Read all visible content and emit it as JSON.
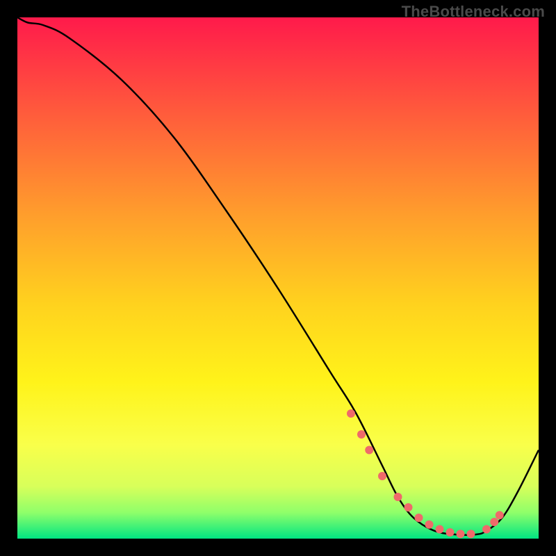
{
  "watermark": "TheBottleneck.com",
  "chart_data": {
    "type": "line",
    "title": "",
    "xlabel": "",
    "ylabel": "",
    "xlim": [
      0,
      100
    ],
    "ylim": [
      0,
      100
    ],
    "grid": false,
    "legend": false,
    "gradient_stops": [
      {
        "offset": 0.0,
        "color": "#ff1a4b"
      },
      {
        "offset": 0.18,
        "color": "#ff5a3c"
      },
      {
        "offset": 0.38,
        "color": "#ff9e2c"
      },
      {
        "offset": 0.55,
        "color": "#ffd21e"
      },
      {
        "offset": 0.7,
        "color": "#fff31a"
      },
      {
        "offset": 0.82,
        "color": "#f9ff4a"
      },
      {
        "offset": 0.9,
        "color": "#d8ff5a"
      },
      {
        "offset": 0.95,
        "color": "#8fff6a"
      },
      {
        "offset": 1.0,
        "color": "#00e582"
      }
    ],
    "series": [
      {
        "name": "bottleneck-curve",
        "color": "#000000",
        "x": [
          0,
          2,
          5,
          10,
          20,
          30,
          40,
          50,
          60,
          65,
          70,
          73,
          76,
          80,
          84,
          88,
          90,
          93,
          96,
          100
        ],
        "y": [
          100,
          99,
          98.5,
          96,
          88,
          77,
          63,
          48,
          32,
          24,
          14,
          8,
          4,
          1.5,
          0.8,
          0.8,
          1.5,
          4,
          9,
          17
        ]
      }
    ],
    "markers": {
      "name": "highlight-dots",
      "color": "#ef6a6a",
      "radius": 6,
      "x": [
        64,
        66,
        67.5,
        70,
        73,
        75,
        77,
        79,
        81,
        83,
        85,
        87,
        90,
        91.5,
        92.5
      ],
      "y": [
        24,
        20,
        17,
        12,
        8,
        6,
        4,
        2.7,
        1.8,
        1.2,
        0.9,
        0.9,
        1.8,
        3.2,
        4.5
      ]
    }
  }
}
